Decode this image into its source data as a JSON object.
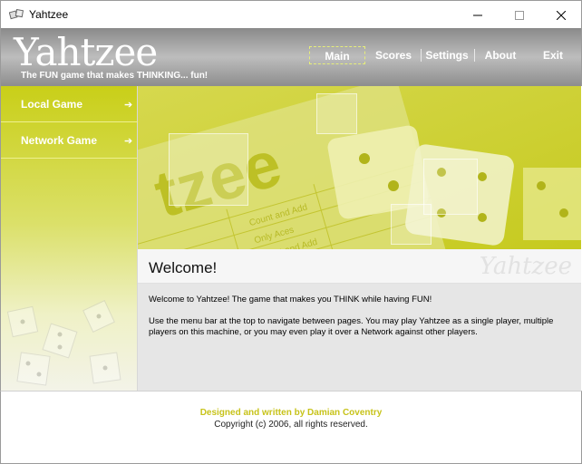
{
  "window": {
    "title": "Yahtzee"
  },
  "header": {
    "logo": "Yahtzee",
    "tagline": "The FUN game that makes THINKING... fun!",
    "nav": [
      "Main",
      "Scores",
      "Settings",
      "About",
      "Exit"
    ],
    "active_nav": "Main"
  },
  "sidebar": {
    "items": [
      {
        "label": "Local Game",
        "arrow": "➔"
      },
      {
        "label": "Network Game",
        "arrow": "➔"
      }
    ]
  },
  "content": {
    "title": "Welcome!",
    "watermark": "Yahtzee",
    "paragraphs": [
      "Welcome to Yahtzee! The game that makes you THINK while having FUN!",
      "Use the menu bar at the top to navigate between pages.  You may play Yahtzee as a single player, multiple players on this machine, or you may even play it over a Network against other players."
    ]
  },
  "footer": {
    "credit": "Designed and written by Damian Coventry",
    "copyright": "Copyright (c) 2006, all rights reserved."
  },
  "colors": {
    "accent": "#cdd034",
    "accent_light": "#eff1c6",
    "header_gray": "#a8a8a8",
    "credit": "#c7c31a"
  }
}
